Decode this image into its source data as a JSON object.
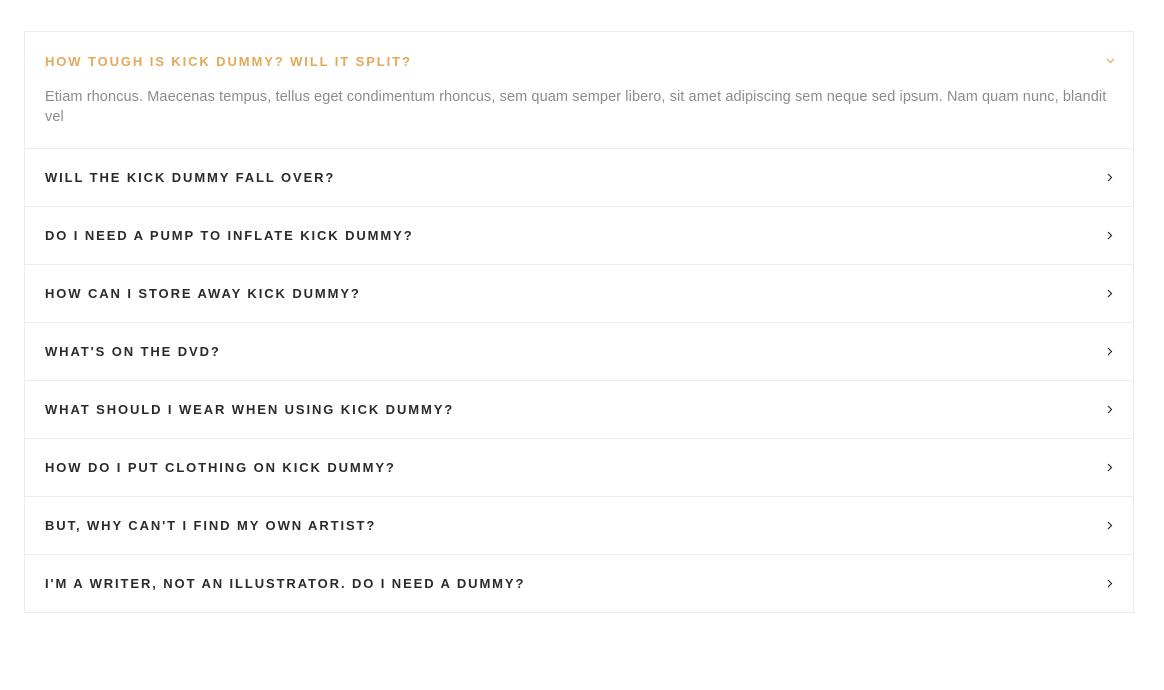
{
  "faq": {
    "items": [
      {
        "question": "HOW TOUGH IS KICK DUMMY? WILL IT SPLIT?",
        "answer": "Etiam rhoncus. Maecenas tempus, tellus eget condimentum rhoncus, sem quam semper libero, sit amet adipiscing sem neque sed ipsum. Nam quam nunc, blandit vel",
        "expanded": true,
        "icon": "chevron-down-icon"
      },
      {
        "question": "WILL THE KICK DUMMY FALL OVER?",
        "expanded": false,
        "icon": "chevron-right-icon"
      },
      {
        "question": "DO I NEED A PUMP TO INFLATE KICK DUMMY?",
        "expanded": false,
        "icon": "chevron-right-icon"
      },
      {
        "question": "HOW CAN I STORE AWAY KICK DUMMY?",
        "expanded": false,
        "icon": "chevron-right-icon"
      },
      {
        "question": "WHAT'S ON THE DVD?",
        "expanded": false,
        "icon": "chevron-right-icon"
      },
      {
        "question": "WHAT SHOULD I WEAR WHEN USING KICK DUMMY?",
        "expanded": false,
        "icon": "chevron-right-icon"
      },
      {
        "question": "HOW DO I PUT CLOTHING ON KICK DUMMY?",
        "expanded": false,
        "icon": "chevron-right-icon"
      },
      {
        "question": "BUT, WHY CAN'T I FIND MY OWN ARTIST?",
        "expanded": false,
        "icon": "chevron-right-icon"
      },
      {
        "question": "I'M A WRITER, NOT AN ILLUSTRATOR. DO I NEED A DUMMY?",
        "expanded": false,
        "icon": "chevron-right-icon"
      }
    ]
  },
  "colors": {
    "accent": "#e2a95a",
    "question_text": "#2b2b2b",
    "answer_text": "#8c8c8c",
    "border": "#ececec"
  }
}
